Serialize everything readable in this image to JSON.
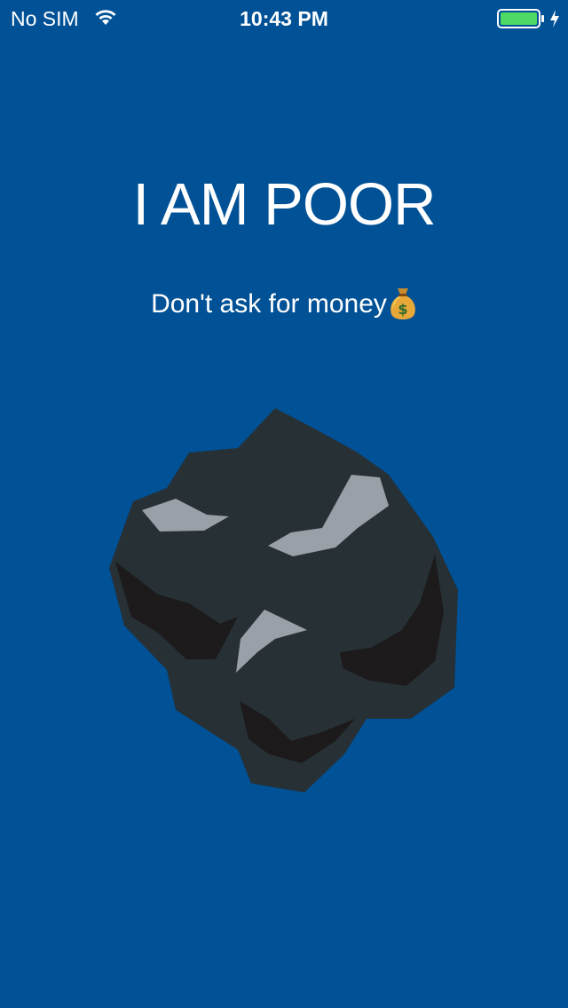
{
  "status_bar": {
    "carrier": "No SIM",
    "time": "10:43 PM",
    "wifi_icon": "wifi-icon",
    "battery_icon": "battery-icon",
    "charging_icon": "charging-bolt-icon"
  },
  "main": {
    "title": "I AM POOR",
    "subtitle": "Don't ask for money",
    "subtitle_icon": "money-bag-icon",
    "illustration": "coal-illustration"
  },
  "colors": {
    "background": "#005196",
    "text": "#ffffff",
    "battery_fill": "#4cd964",
    "coal_body": "#263035",
    "coal_shadow": "#1c1a1b",
    "coal_highlight": "#9aa0a8"
  }
}
